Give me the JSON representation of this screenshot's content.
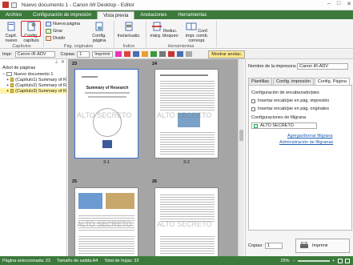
{
  "window": {
    "title": "Nuevo documento 1 - Canon iW Desktop - Editor",
    "controls": [
      "–",
      "□",
      "✕"
    ]
  },
  "tabs": [
    {
      "label": "Archivo"
    },
    {
      "label": "Configuración de impresión"
    },
    {
      "label": "Vista previa"
    },
    {
      "label": "Anotaciones"
    },
    {
      "label": "Herramientas"
    }
  ],
  "ribbon": {
    "cap_nuevo": "Capít. nuevo",
    "config_capitulo": "Config. capítulo",
    "nueva_pagina": "Nueva página",
    "girar": "Girar",
    "dividir": "Dividir",
    "config_pagina": "Config. página",
    "ins_actualiz": "Ins/actualiz.",
    "reduc_marg": "Reduc. márg. bloqueo",
    "conf_impr_comb": "Conf. impr. comb. correspi.",
    "groups": {
      "capitulos": "Capítulos",
      "pag_originales": "Pág. originales",
      "indice": "Índice",
      "herramientas": "Herramientas"
    }
  },
  "toolbar": {
    "impr_label": "Impr:",
    "printer": "Canon iR-ADV",
    "copias_label": "Copias:",
    "copias": "1",
    "imprimir": "Imprimir",
    "mostrar_anotac": "Mostrar anotac."
  },
  "left_pane": {
    "title": "Árbol de páginas",
    "root": "Nuevo documento 1",
    "items": [
      "(Capítulo1) Summary of R",
      "(Capítulo2) Summary of R",
      "(Capítulo3) Summary of R"
    ]
  },
  "pages": [
    {
      "num": "23",
      "caption": "3-1",
      "heading": "Summary of Research",
      "watermark": "ALTO SECRETO"
    },
    {
      "num": "24",
      "caption": "3-2",
      "heading": "",
      "watermark": "ALTO SECRETO"
    },
    {
      "num": "25",
      "caption": "",
      "heading": "",
      "watermark": "ALTO SECRETO"
    },
    {
      "num": "26",
      "caption": "",
      "heading": "",
      "watermark": "ALTO SECRETO"
    }
  ],
  "right_pane": {
    "printer_label": "Nombre de la impresora:",
    "printer_value": "Canon iR-ADV",
    "tabs": [
      "Plantillas",
      "Config. impresión",
      "Config. Página"
    ],
    "section_title": "Configuración de encabezado/pies",
    "checks": [
      "Insertar encab/pie en pág. impresión",
      "Insertar encab/pie en pág. originales"
    ],
    "watermark_section": "Configuraciones de filigrana",
    "watermark_value": "ALTO SECRETO",
    "link1": "Agregar/borrar filigrana",
    "link2": "Administración de filigranas",
    "copies_label": "Copias:",
    "copies_value": "1",
    "print_button": "Imprimir"
  },
  "status": {
    "selected": "Página seleccionada: 23",
    "output_size": "Tamaño de salida:A4",
    "total": "Total de hojas: 33",
    "zoom": "25%"
  },
  "colors": {
    "accent": "#3c7a3c",
    "highlight": "#e02020",
    "canvas": "#a5a5a5"
  }
}
